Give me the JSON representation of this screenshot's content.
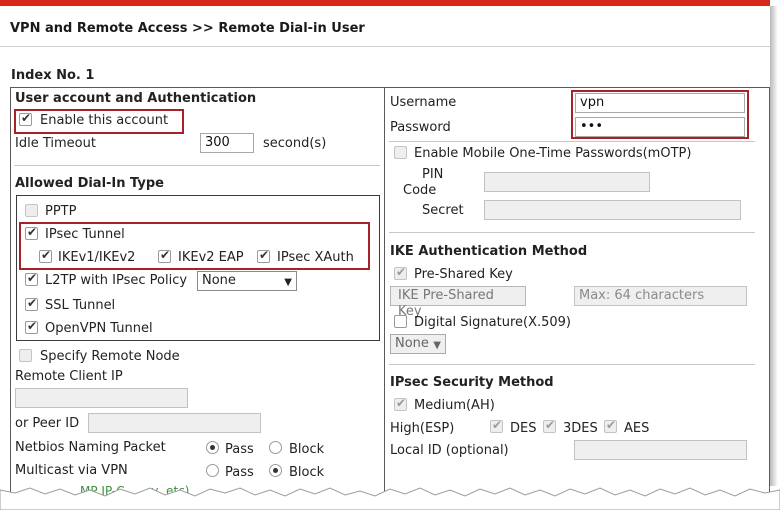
{
  "breadcrumb": "VPN and Remote Access >> Remote Dial-in User",
  "index_label": "Index No. 1",
  "left": {
    "section_title": "User account and Authentication",
    "enable_account": "Enable this account",
    "idle_timeout_label": "Idle Timeout",
    "idle_timeout_value": "300",
    "idle_timeout_unit": "second(s)",
    "dialin_title": "Allowed Dial-In Type",
    "pptp": "PPTP",
    "ipsec_tunnel": "IPsec Tunnel",
    "ikev1": "IKEv1/IKEv2",
    "ikev2_eap": "IKEv2 EAP",
    "ipsec_xauth": "IPsec XAuth",
    "l2tp": "L2TP with IPsec Policy",
    "l2tp_select": "None",
    "ssl_tunnel": "SSL Tunnel",
    "openvpn_tunnel": "OpenVPN Tunnel",
    "specify_remote_node": "Specify Remote Node",
    "remote_client_ip": "Remote Client IP",
    "or_peer_id": "or Peer ID",
    "netbios_label": "Netbios Naming Packet",
    "multicast_label": "Multicast via VPN",
    "pass": "Pass",
    "block": "Block",
    "cut_text": "MP IP-C... ...y, etc)"
  },
  "right": {
    "username_label": "Username",
    "username_value": "vpn",
    "password_label": "Password",
    "password_value": "•••",
    "mobile_otp": "Enable Mobile One-Time Passwords(mOTP)",
    "pin": "PIN",
    "code": "Code",
    "secret": "Secret",
    "ike_title": "IKE Authentication Method",
    "preshared": "Pre-Shared Key",
    "preshared_button": "IKE Pre-Shared Key",
    "preshared_placeholder": "Max: 64 characters",
    "digital_sig": "Digital Signature(X.509)",
    "sig_select": "None",
    "ipsec_title": "IPsec Security Method",
    "medium": "Medium(AH)",
    "high": "High(ESP)",
    "des": "DES",
    "des3": "3DES",
    "aes": "AES",
    "local_id": "Local ID (optional)"
  }
}
